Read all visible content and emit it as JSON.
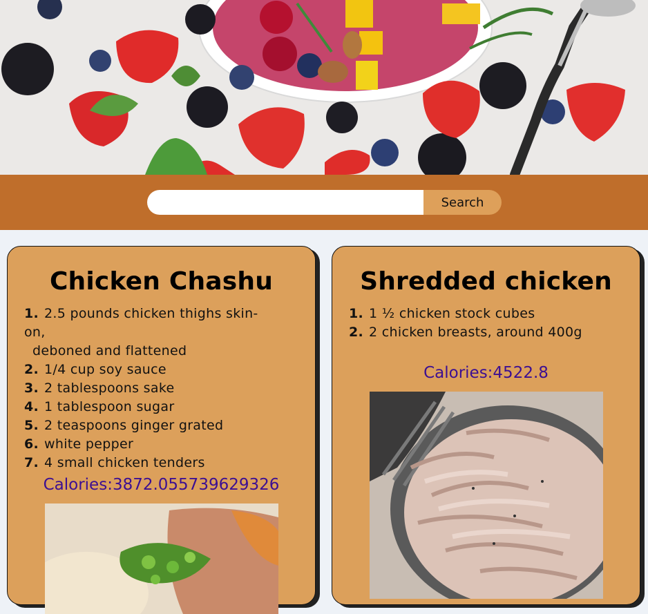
{
  "search": {
    "input_value": "",
    "placeholder": "",
    "button_label": "Search"
  },
  "recipes": [
    {
      "title": "Chicken Chashu",
      "ingredients": [
        {
          "num": "1.",
          "text": "2.5 pounds chicken thighs skin-on,",
          "text2": "deboned and flattened"
        },
        {
          "num": "2.",
          "text": "1/4 cup soy sauce"
        },
        {
          "num": "3.",
          "text": "2 tablespoons sake"
        },
        {
          "num": "4.",
          "text": "1 tablespoon sugar"
        },
        {
          "num": "5.",
          "text": "2 teaspoons ginger grated"
        },
        {
          "num": "6.",
          "text": "white pepper"
        },
        {
          "num": "7.",
          "text": "4 small chicken tenders"
        }
      ],
      "calories": "Calories:3872.055739629326"
    },
    {
      "title": "Shredded chicken",
      "ingredients": [
        {
          "num": "1.",
          "text": "1 ½ chicken stock cubes"
        },
        {
          "num": "2.",
          "text": "2 chicken breasts, around 400g"
        }
      ],
      "calories": "Calories:4522.8"
    }
  ],
  "colors": {
    "band": "#bf6e2b",
    "card": "#dca05b",
    "button": "#dea05a",
    "calories": "#3c0f92",
    "page_bg": "#eef2f7"
  }
}
